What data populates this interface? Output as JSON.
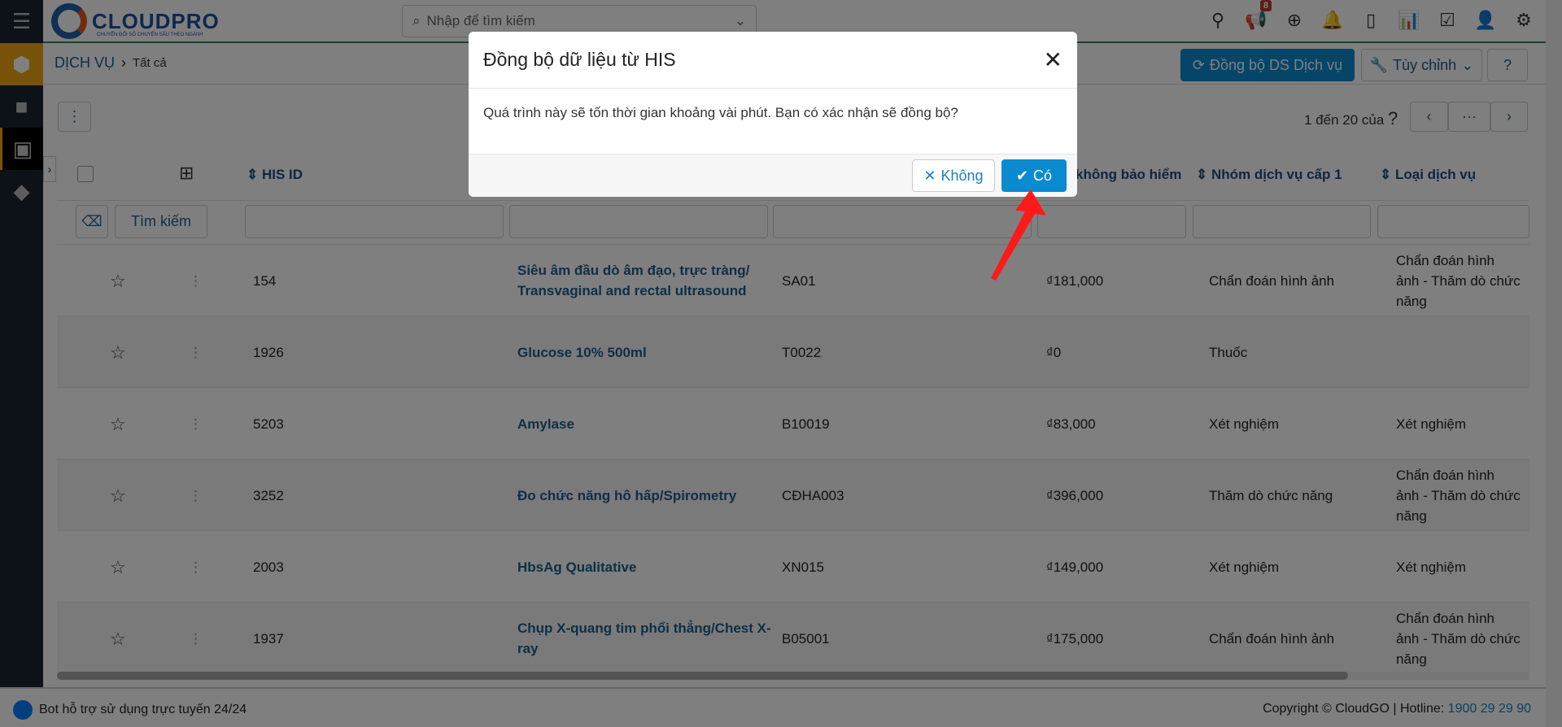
{
  "app": {
    "logo": "CLOUDPRO",
    "logo_tagline": "CHUYỂN ĐỔI SỐ CHUYÊN SÂU THEO NGÀNH",
    "search_placeholder": "Nhập để tìm kiếm",
    "notification_count": "8"
  },
  "header_icons": [
    "map-pin-icon",
    "megaphone-icon",
    "plus-circle-icon",
    "bell-icon",
    "calendar-icon",
    "chart-icon",
    "checkbox-icon",
    "user-icon",
    "gear-icon"
  ],
  "breadcrumb": {
    "module": "DỊCH VỤ",
    "current": "Tất cả"
  },
  "actions": {
    "sync": "Đồng bộ DS Dịch vụ",
    "customize": "Tùy chỉnh"
  },
  "pagination": {
    "range": "1 đến 20 của",
    "total": "?",
    "more": "···"
  },
  "table": {
    "columns": [
      "HIS ID",
      "",
      "",
      "không bảo hiểm",
      "Nhóm dịch vụ cấp 1",
      "Loại dịch vụ"
    ],
    "search_button": "Tìm kiếm",
    "rows": [
      {
        "id": "154",
        "name": "Siêu âm đầu dò âm đạo, trực tràng/ Transvaginal and rectal ultrasound",
        "code": "SA01",
        "price": "₫181,000",
        "group": "Chẩn đoán hình ảnh",
        "type": "Chẩn đoán hình ảnh - Thăm dò chức năng"
      },
      {
        "id": "1926",
        "name": "Glucose 10% 500ml",
        "code": "T0022",
        "price": "₫0",
        "group": "Thuốc",
        "type": ""
      },
      {
        "id": "5203",
        "name": "Amylase",
        "code": "B10019",
        "price": "₫83,000",
        "group": "Xét nghiệm",
        "type": "Xét nghiệm"
      },
      {
        "id": "3252",
        "name": "Đo chức năng hô hấp/Spirometry",
        "code": "CĐHA003",
        "price": "₫396,000",
        "group": "Thăm dò chức năng",
        "type": "Chẩn đoán hình ảnh - Thăm dò chức năng"
      },
      {
        "id": "2003",
        "name": "HbsAg Qualitative",
        "code": "XN015",
        "price": "₫149,000",
        "group": "Xét nghiệm",
        "type": "Xét nghiệm"
      },
      {
        "id": "1937",
        "name": "Chụp X-quang tim phổi thẳng/Chest X-ray",
        "code": "B05001",
        "price": "₫175,000",
        "group": "Chẩn đoán hình ảnh",
        "type": "Chẩn đoán hình ảnh - Thăm dò chức năng"
      }
    ]
  },
  "footer": {
    "bot": "Bot hỗ trợ sử dụng trực tuyến 24/24",
    "copyright": "Copyright © CloudGO",
    "hotline_label": "Hotline:",
    "hotline": "1900 29 29 90"
  },
  "modal": {
    "title": "Đồng bộ dữ liệu từ HIS",
    "message": "Quá trình này sẽ tốn thời gian khoảng vài phút. Bạn có xác nhận sẽ đồng bộ?",
    "cancel": "Không",
    "confirm": "Có"
  },
  "colors": {
    "primary": "#0a8ad0",
    "link": "#1b5e8c",
    "sidebar": "#1b2430",
    "sidebar_active": "#f3a712",
    "arrow": "#ff1a1a"
  }
}
